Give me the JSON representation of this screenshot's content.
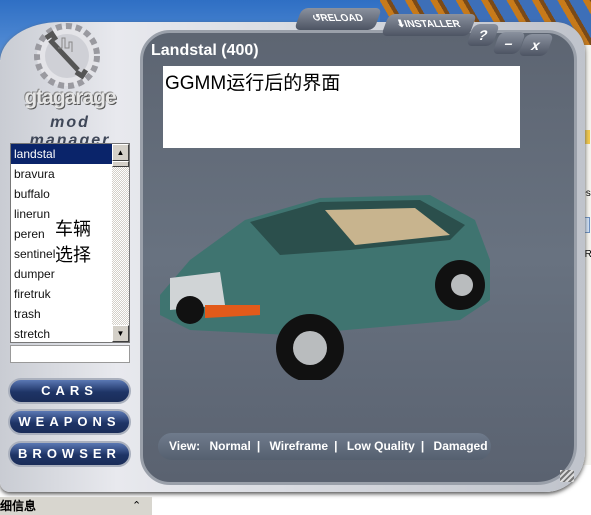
{
  "app": {
    "logo_text": "gtagarage",
    "logo_subtitle": "mod manager"
  },
  "toolbar": {
    "reload": "RELOAD",
    "installer": "INSTALLER",
    "help": "?",
    "minimize": "–",
    "close": "x"
  },
  "vehicle_title": "Landstal (400)",
  "annotations": {
    "main": "GGMM运行后的界面",
    "list": "车辆选择"
  },
  "vehicle_list": {
    "selected": "landstal",
    "items": [
      "landstal",
      "bravura",
      "buffalo",
      "linerun",
      "peren",
      "sentinel",
      "dumper",
      "firetruk",
      "trash",
      "stretch"
    ]
  },
  "nav": {
    "cars": "CARS",
    "weapons": "WEAPONS",
    "browser": "BROWSER"
  },
  "view": {
    "label": "View:",
    "options": [
      "Normal",
      "Wireframe",
      "Low Quality",
      "Damaged"
    ]
  },
  "desktop": {
    "label1": "ies",
    "label2": "ER"
  },
  "info_panel": {
    "title": "细信息",
    "chevron": "⌃"
  },
  "colors": {
    "nav_button": "#1e3466",
    "panel": "#636c7a",
    "selection": "#0a246a"
  }
}
